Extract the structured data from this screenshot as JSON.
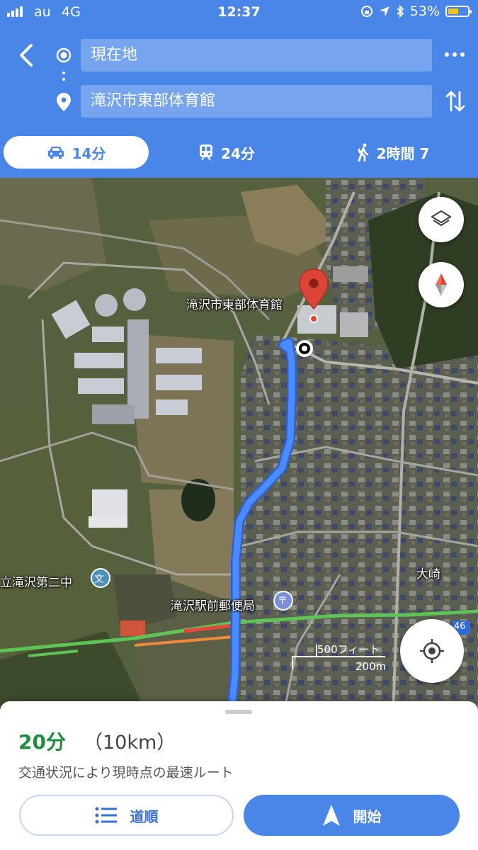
{
  "status_bar": {
    "carrier": "au",
    "network": "4G",
    "time": "12:37",
    "battery": "53%",
    "battery_level": 0.53
  },
  "route_inputs": {
    "origin": "現在地",
    "destination": "滝沢市東部体育館"
  },
  "travel_modes": [
    {
      "icon": "car-icon",
      "label": "14分",
      "active": true
    },
    {
      "icon": "train-icon",
      "label": "24分",
      "active": false
    },
    {
      "icon": "walk-icon",
      "label": "2時間 7",
      "active": false
    }
  ],
  "map": {
    "labels": {
      "destination": "滝沢市東部体育館",
      "school": "立滝沢第二中",
      "post_office": "滝沢駅前郵便局",
      "district": "大崎",
      "road_number": "46",
      "school_icon_glyph": "文",
      "post_icon_glyph": "〒"
    },
    "scale": {
      "imperial": "500フィート",
      "metric": "200m"
    }
  },
  "route_summary": {
    "duration": "20分",
    "distance": "（10km）",
    "note": "交通状況により現時点の最速ルート"
  },
  "actions": {
    "steps_label": "道順",
    "start_label": "開始"
  },
  "colors": {
    "header_blue": "#4a86e8",
    "route_blue": "#4a8cff",
    "eta_green": "#1e8e3e",
    "pin_red": "#db4437"
  }
}
